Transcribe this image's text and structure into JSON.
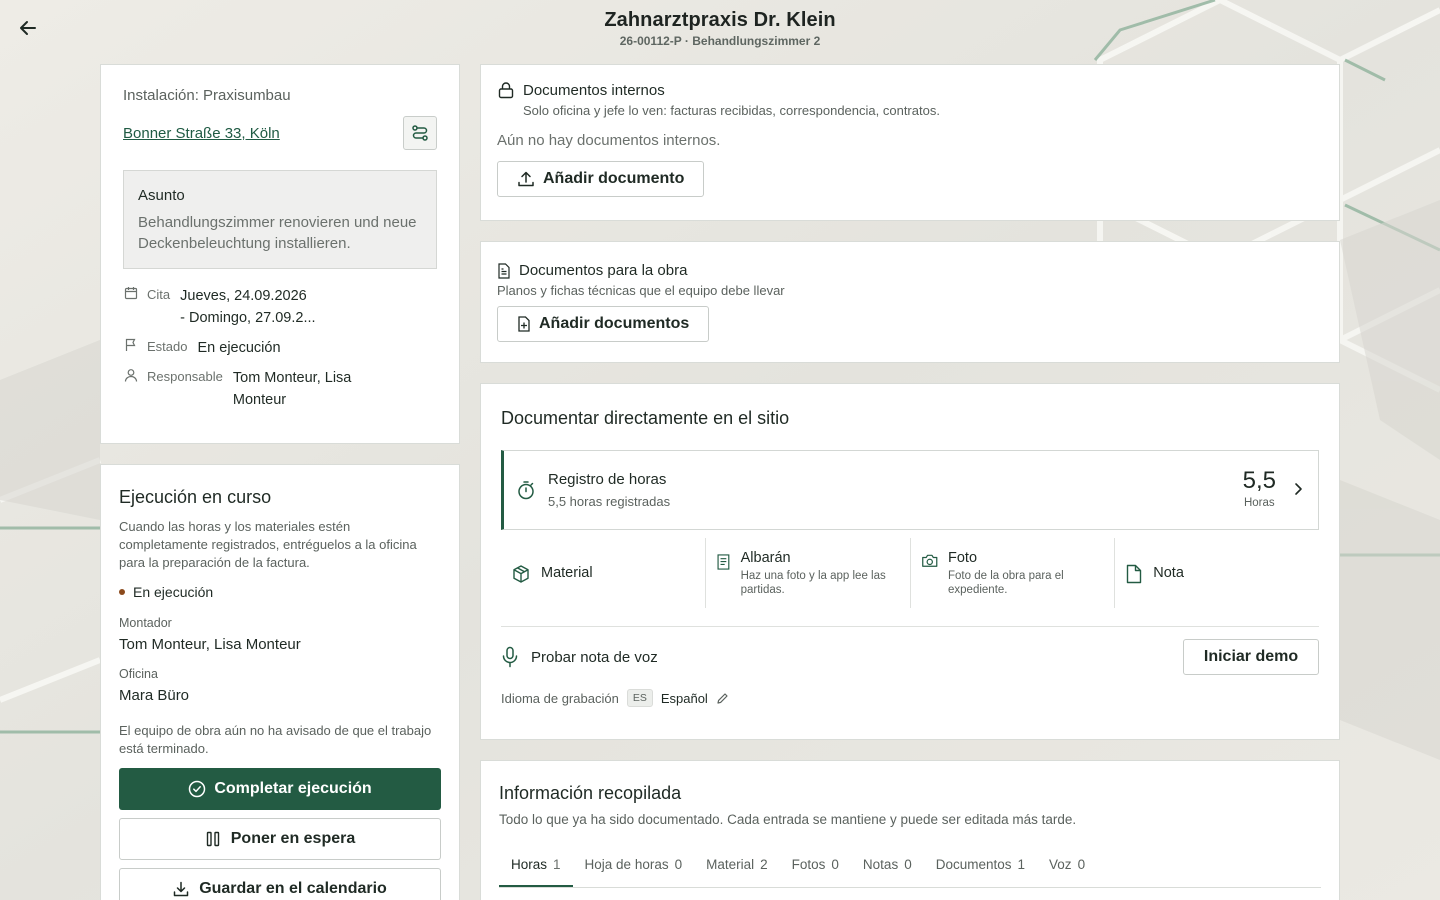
{
  "header": {
    "title": "Zahnarztpraxis Dr. Klein",
    "subtitle": "26-00112-P · Behandlungszimmer 2"
  },
  "info": {
    "installation_label": "Instalación: Praxisumbau",
    "address": "Bonner Straße 33, Köln",
    "subject_title": "Asunto",
    "subject_text": "Behandlungszimmer renovieren und neue Deckenbeleuchtung installieren.",
    "appointment_key": "Cita",
    "appointment_line1": "Jueves, 24.09.2026",
    "appointment_line2": "- Domingo, 27.09.2...",
    "status_key": "Estado",
    "status_val": "En ejecución",
    "responsible_key": "Responsable",
    "responsible_val": "Tom Monteur, Lisa Monteur"
  },
  "execution": {
    "title": "Ejecución en curso",
    "description": "Cuando las horas y los materiales estén completamente registrados, entréguelos a la oficina para la preparación de la factura.",
    "status": "En ejecución",
    "fitter_key": "Montador",
    "fitter_val": "Tom Monteur, Lisa Monteur",
    "office_key": "Oficina",
    "office_val": "Mara Büro",
    "note": "El equipo de obra aún no ha avisado de que el trabajo está terminado.",
    "complete_btn": "Completar ejecución",
    "hold_btn": "Poner en espera",
    "calendar_btn": "Guardar en el calendario"
  },
  "internal_docs": {
    "title": "Documentos internos",
    "subtitle": "Solo oficina y jefe lo ven: facturas recibidas, correspondencia, contratos.",
    "empty": "Aún no hay documentos internos.",
    "add_btn": "Añadir documento"
  },
  "site_docs": {
    "title": "Documentos para la obra",
    "subtitle": "Planos y fichas técnicas que el equipo debe llevar",
    "add_btn": "Añadir documentos"
  },
  "direct": {
    "title": "Documentar directamente en el sitio",
    "hours_title": "Registro de horas",
    "hours_sub": "5,5 horas registradas",
    "hours_value": "5,5",
    "hours_unit": "Horas",
    "actions": [
      {
        "title": "Material",
        "sub": ""
      },
      {
        "title": "Albarán",
        "sub": "Haz una foto y la app lee las partidas."
      },
      {
        "title": "Foto",
        "sub": "Foto de la obra para el expediente."
      },
      {
        "title": "Nota",
        "sub": ""
      }
    ],
    "voice_label": "Probar nota de voz",
    "demo_btn": "Iniciar demo",
    "lang_label": "Idioma de grabación",
    "lang_code": "ES",
    "lang_value": "Español"
  },
  "collected": {
    "title": "Información recopilada",
    "subtitle": "Todo lo que ya ha sido documentado. Cada entrada se mantiene y puede ser editada más tarde.",
    "tabs": [
      {
        "label": "Horas",
        "count": "1"
      },
      {
        "label": "Hoja de horas",
        "count": "0"
      },
      {
        "label": "Material",
        "count": "2"
      },
      {
        "label": "Fotos",
        "count": "0"
      },
      {
        "label": "Notas",
        "count": "0"
      },
      {
        "label": "Documentos",
        "count": "1"
      },
      {
        "label": "Voz",
        "count": "0"
      }
    ]
  },
  "colors": {
    "accent": "#235b43",
    "status_dot": "#8b4a1c"
  }
}
